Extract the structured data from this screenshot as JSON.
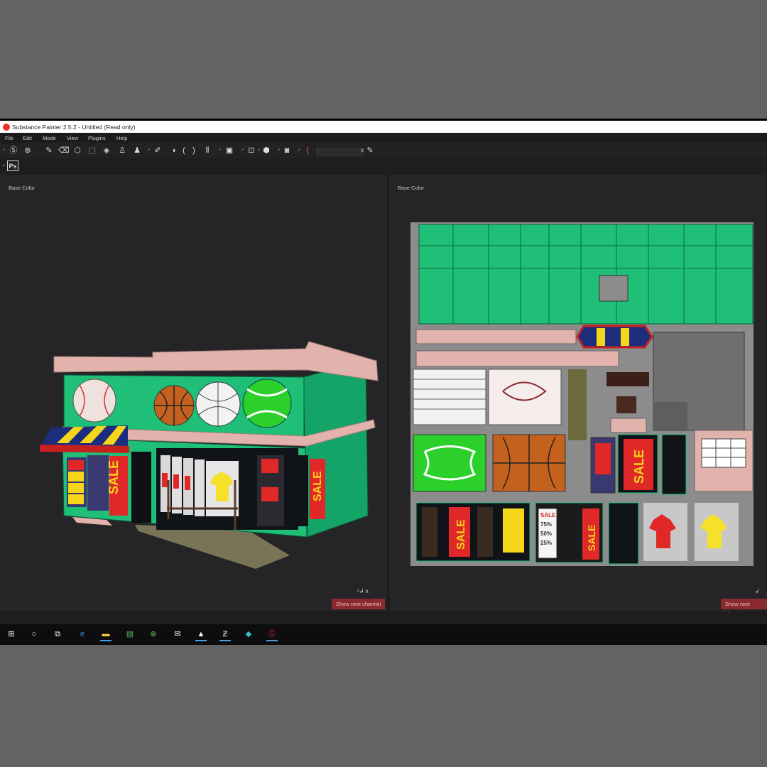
{
  "app": {
    "title": "Substance Painter 2.5.2 - Untitled (Read only)"
  },
  "menu": [
    "File",
    "Edit",
    "Mode",
    "View",
    "Plugins",
    "Help"
  ],
  "toolbar": {
    "icons": [
      "substance-s-icon",
      "substance-s2-icon",
      "paint-brush-icon",
      "eraser-icon",
      "projection-icon",
      "selection-icon",
      "polygon-fill-icon",
      "smudge-icon",
      "clone-stamp-icon",
      "stamp-icon",
      "color-picker-icon",
      "symmetry-icon",
      "mirror-icon",
      "viewport-icon",
      "display-icon",
      "cube-view-icon",
      "camera-icon"
    ],
    "brush_size_value": "8"
  },
  "toolbar2": {
    "photoshop_label": "Ps"
  },
  "viewports": {
    "left": {
      "channel_label": "Base Color",
      "next_channel_label": "Show next channel"
    },
    "right": {
      "channel_label": "Base Color",
      "next_channel_label": "Show next channel"
    }
  },
  "uv_texts": {
    "sale": "SALE",
    "pct75": "75%",
    "pct50": "50%",
    "pct25": "25%"
  },
  "taskbar": {
    "icons": [
      "windows-start-icon",
      "cortana-search-icon",
      "task-view-icon",
      "edge-browser-icon",
      "file-explorer-icon",
      "network-app-icon",
      "xbox-icon",
      "mail-icon",
      "photos-icon",
      "zbrush-icon",
      "3d-app-icon",
      "substance-painter-icon"
    ]
  },
  "colors": {
    "store_green": "#1fbf77",
    "trim_pink": "#e2b3ad",
    "sale_red": "#e02828",
    "sale_yellow": "#f5d61a",
    "awning_blue": "#1b2d7c",
    "next_channel_btn": "#8b2a2e"
  }
}
